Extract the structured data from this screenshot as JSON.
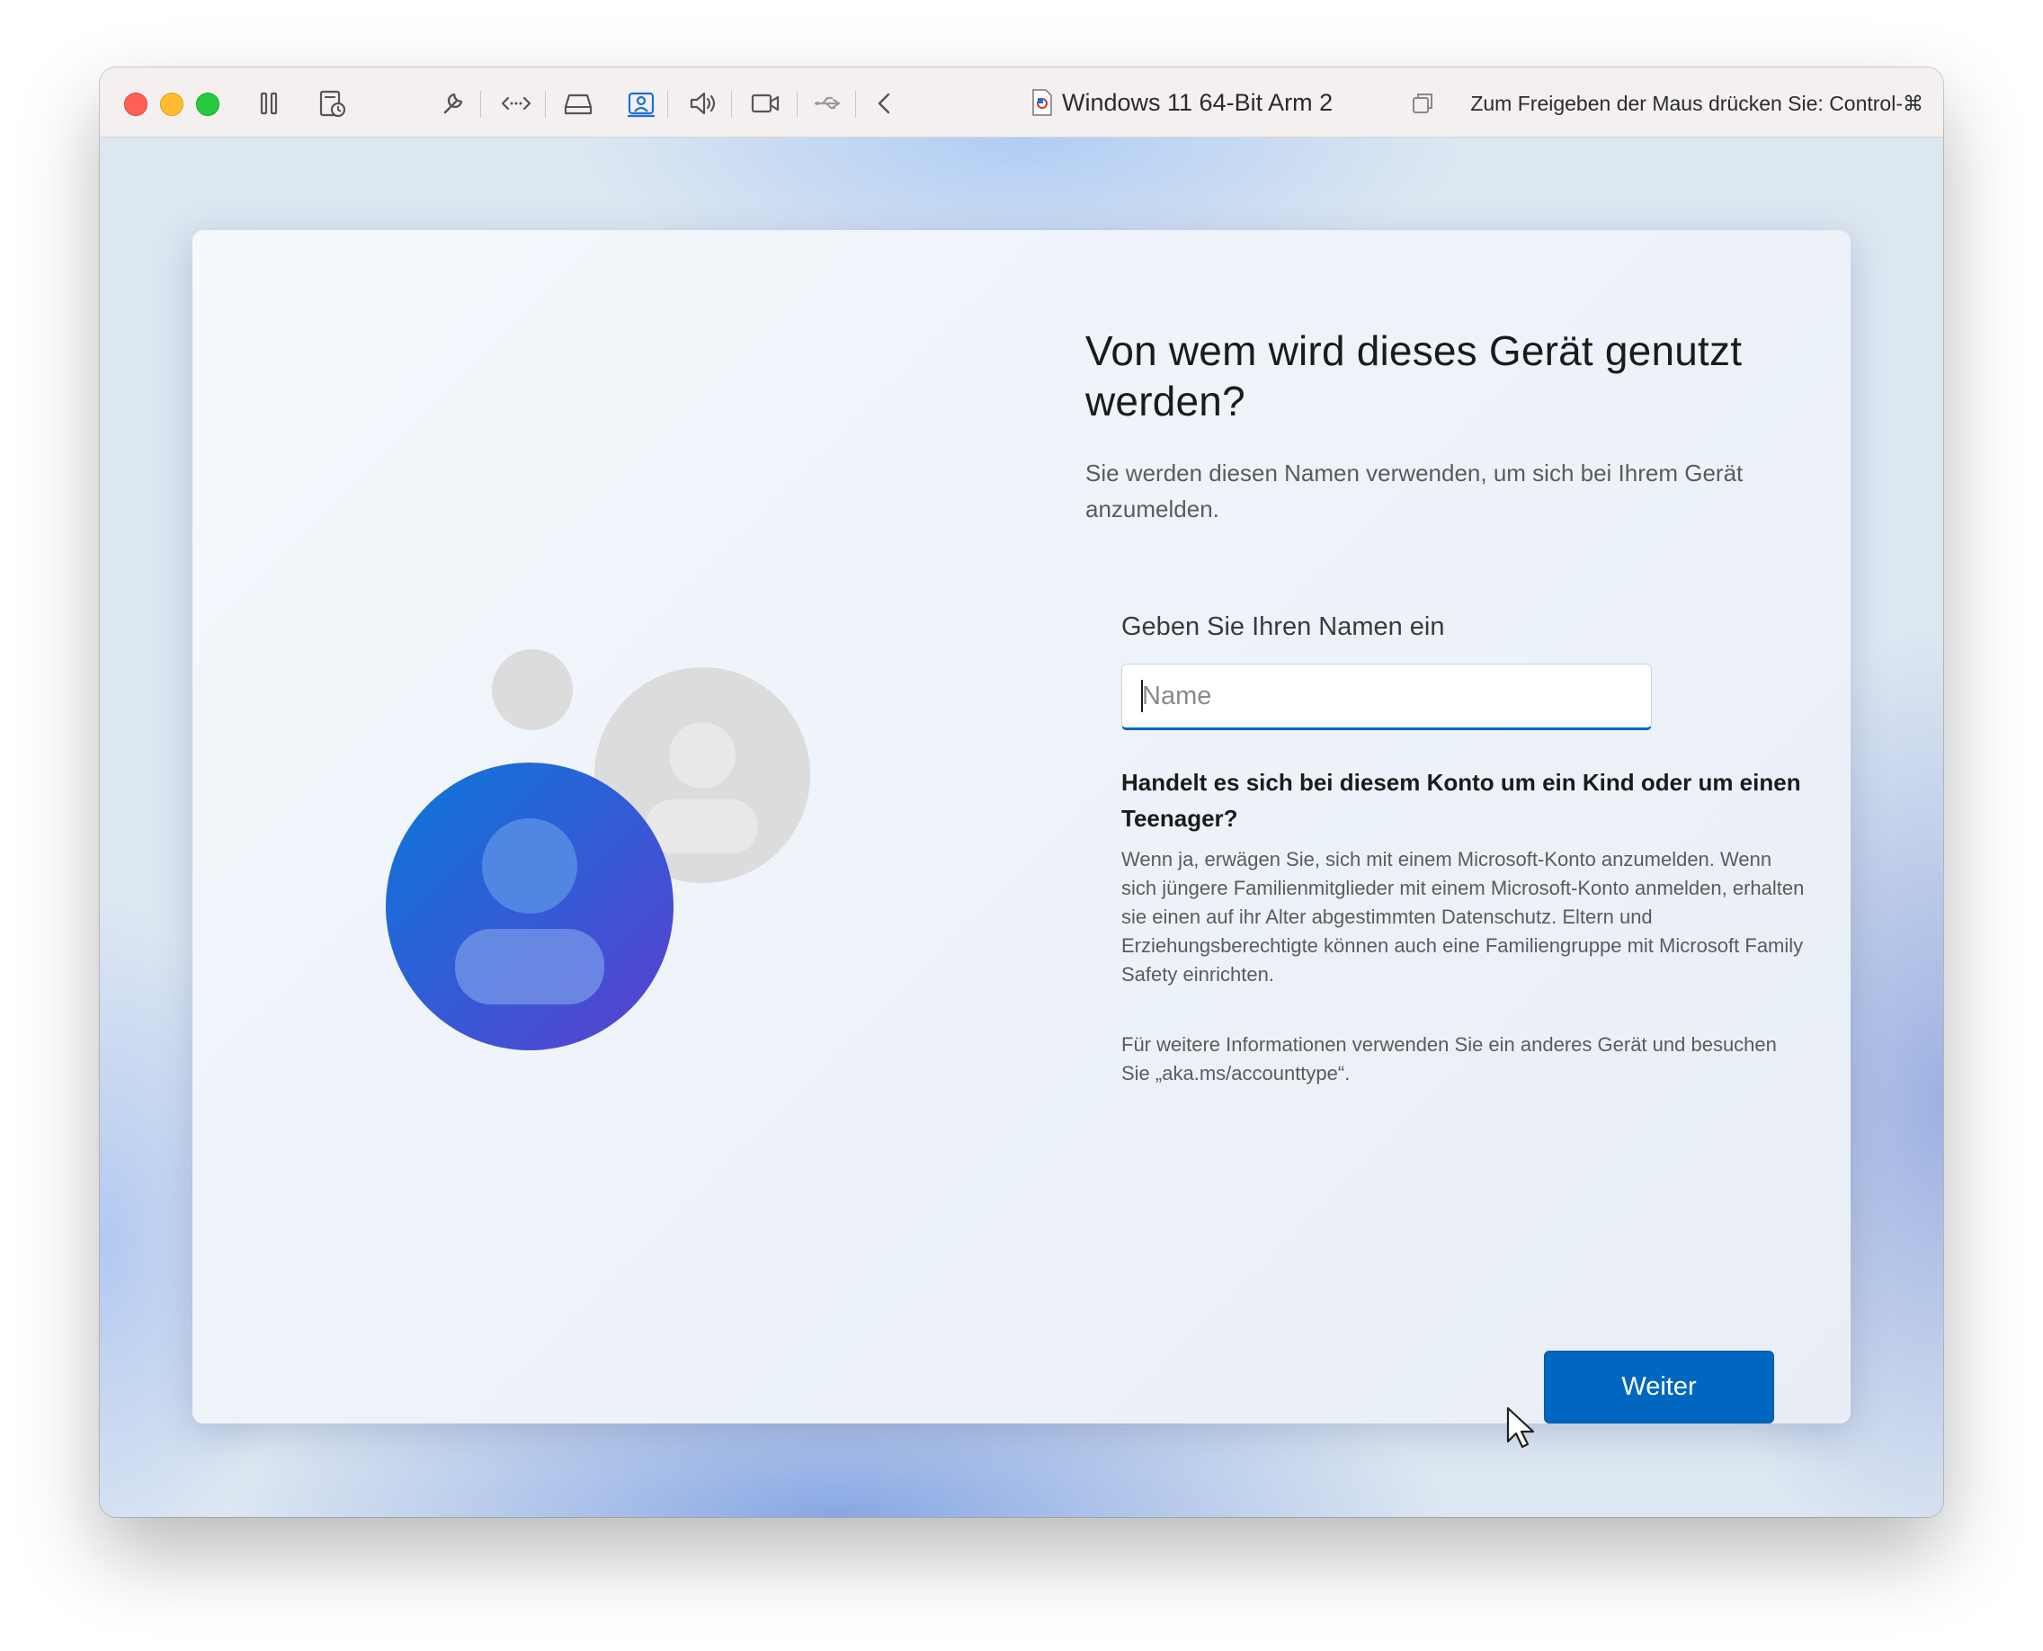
{
  "titlebar": {
    "window_title": "Windows 11 64-Bit Arm 2",
    "release_hint": "Zum Freigeben der Maus drücken Sie: Control-⌘",
    "icons": [
      "close-button",
      "minimize-button",
      "zoom-button",
      "pause-icon",
      "snapshot-icon",
      "settings-wrench-icon",
      "network-icon",
      "hard-disk-icon",
      "camera-sharing-icon",
      "sound-icon",
      "video-camera-icon",
      "usb-icon",
      "back-chevron-icon",
      "document-icon",
      "copy-icon"
    ],
    "traffic_light_colors": {
      "close": "#fe5f57",
      "minimize": "#febc2e",
      "zoom": "#28c840"
    }
  },
  "oobe": {
    "heading": "Von wem wird dieses Gerät genutzt werden?",
    "subtitle": "Sie werden diesen Namen verwenden, um sich bei Ihrem Gerät anzumelden.",
    "input_label": "Geben Sie Ihren Namen ein",
    "name_placeholder": "Name",
    "name_value": "",
    "question_heading": "Handelt es sich bei diesem Konto um ein Kind oder um einen Teenager?",
    "question_body": "Wenn ja, erwägen Sie, sich mit einem Microsoft-Konto anzumelden. Wenn sich jüngere Familienmitglieder mit einem Microsoft-Konto anmelden, erhalten sie einen auf ihr Alter abgestimmten Datenschutz. Eltern und Erziehungsberechtigte können auch eine Familiengruppe mit Microsoft Family Safety einrichten.",
    "more_info": "Für weitere Informationen verwenden Sie ein anderes Gerät und besuchen Sie „aka.ms/accounttype“.",
    "next_button": "Weiter",
    "accent_color": "#0067c0"
  },
  "tray": {
    "icons": [
      "accessibility-icon",
      "volume-icon"
    ]
  }
}
